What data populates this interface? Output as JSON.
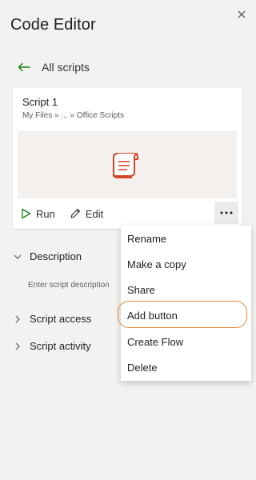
{
  "pane": {
    "title": "Code Editor",
    "back_label": "All scripts"
  },
  "script_card": {
    "name": "Script 1",
    "path": "My Files » ... » Office Scripts",
    "run_label": "Run",
    "edit_label": "Edit"
  },
  "sections": {
    "description_label": "Description",
    "description_placeholder": "Enter script description",
    "access_label": "Script access",
    "activity_label": "Script activity"
  },
  "context_menu": {
    "items": [
      "Rename",
      "Make a copy",
      "Share",
      "Add button",
      "Create Flow",
      "Delete"
    ],
    "highlighted": "Add button"
  },
  "colors": {
    "accent_green": "#107c10",
    "office_orange": "#d24726",
    "highlight_ring": "#e08a3c"
  },
  "icons": {
    "close": "close-icon",
    "back": "arrow-left-icon",
    "script": "office-script-icon",
    "run": "play-icon",
    "edit": "pencil-icon",
    "more": "ellipsis-icon",
    "expand": "chevron-icon"
  }
}
